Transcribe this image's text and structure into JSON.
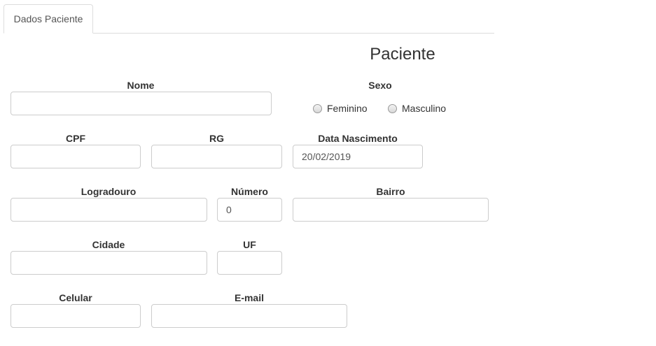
{
  "tabs": [
    {
      "label": "Dados Paciente",
      "active": true
    }
  ],
  "title": "Paciente",
  "fields": {
    "nome": {
      "label": "Nome",
      "value": ""
    },
    "sexo": {
      "label": "Sexo",
      "options": [
        "Feminino",
        "Masculino"
      ],
      "selected": null
    },
    "cpf": {
      "label": "CPF",
      "value": ""
    },
    "rg": {
      "label": "RG",
      "value": ""
    },
    "data_nascimento": {
      "label": "Data Nascimento",
      "value": "20/02/2019"
    },
    "logradouro": {
      "label": "Logradouro",
      "value": ""
    },
    "numero": {
      "label": "Número",
      "value": "0"
    },
    "bairro": {
      "label": "Bairro",
      "value": ""
    },
    "cidade": {
      "label": "Cidade",
      "value": ""
    },
    "uf": {
      "label": "UF",
      "value": ""
    },
    "celular": {
      "label": "Celular",
      "value": ""
    },
    "email": {
      "label": "E-mail",
      "value": ""
    }
  }
}
